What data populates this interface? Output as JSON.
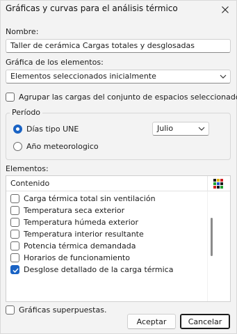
{
  "window": {
    "title": "Gráficas y curvas para el análisis térmico"
  },
  "name_field": {
    "label": "Nombre:",
    "value": "Taller de cerámica Cargas totales y desglosadas"
  },
  "elements_graph": {
    "label": "Gráfica de los elementos:",
    "selected": "Elementos seleccionados inicialmente"
  },
  "group_loads": {
    "label": "Agrupar las cargas del conjunto de espacios seleccionados.",
    "checked": false
  },
  "period": {
    "title": "Período",
    "options": [
      {
        "label": "Días tipo UNE",
        "selected": true
      },
      {
        "label": "Año meteorologico",
        "selected": false
      }
    ],
    "month": "Julio"
  },
  "elements": {
    "label": "Elementos:",
    "column_header": "Contenido",
    "header_icon": "grid-color-icon",
    "rows": [
      {
        "label": "Carga térmica total sin ventilación",
        "checked": false
      },
      {
        "label": "Temperatura seca exterior",
        "checked": false
      },
      {
        "label": "Temperatura húmeda exterior",
        "checked": false
      },
      {
        "label": "Temperatura interior resultante",
        "checked": false
      },
      {
        "label": "Potencia térmica demandada",
        "checked": false
      },
      {
        "label": "Horarios de funcionamiento",
        "checked": false
      },
      {
        "label": "Desglose detallado de la carga térmica",
        "checked": true
      }
    ]
  },
  "overlay": {
    "label": "Gráficas superpuestas.",
    "checked": false
  },
  "buttons": {
    "accept": "Aceptar",
    "cancel": "Cancelar"
  },
  "colors": {
    "accent": "#1a63c4"
  }
}
